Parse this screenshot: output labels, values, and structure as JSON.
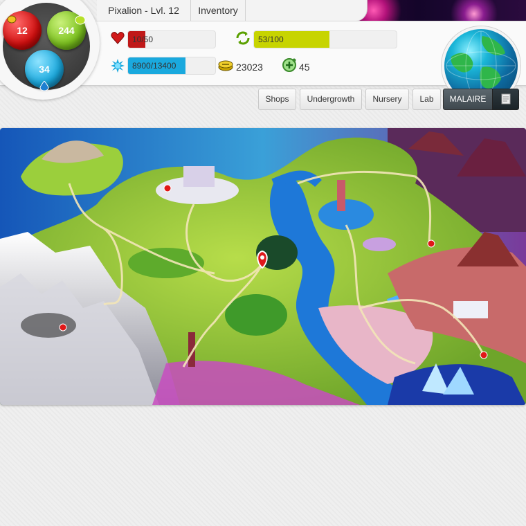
{
  "header": {
    "title_tab": "Pixalion - Lvl. 12",
    "inventory_tab": "Inventory"
  },
  "orb": {
    "red_value": "12",
    "green_value": "244",
    "blue_value": "34"
  },
  "stats": {
    "health": {
      "text": "10/50",
      "fraction": 0.2,
      "color": "#c01818",
      "icon": "heart-icon"
    },
    "energy": {
      "text": "53/100",
      "fraction": 0.53,
      "color": "#c7d400",
      "icon": "recycle-icon"
    },
    "experience": {
      "text": "8900/13400",
      "fraction": 0.66,
      "color": "#1aa9de",
      "icon": "star-burst-icon"
    },
    "coins": {
      "value": "23023",
      "icon": "coin-stack-icon"
    },
    "gems": {
      "value": "45",
      "icon": "plus-coin-icon"
    }
  },
  "nav": {
    "shops": "Shops",
    "undergrowth": "Undergrowth",
    "nursery": "Nursery",
    "lab": "Lab",
    "malaire": "MALAIRE",
    "scroll_icon": "scroll-icon"
  },
  "colors": {
    "health": "#c01818",
    "energy": "#c7d400",
    "experience": "#1aa9de",
    "malaire_button": "#4a545a"
  }
}
